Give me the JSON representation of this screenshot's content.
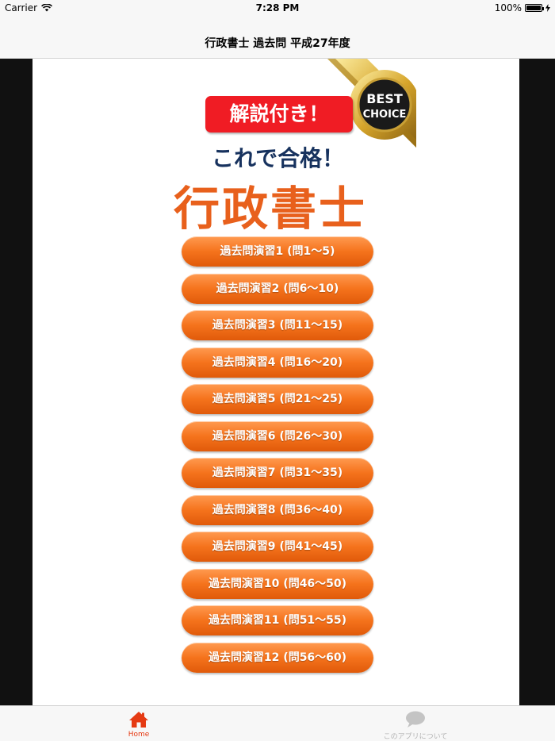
{
  "status": {
    "carrier": "Carrier",
    "time": "7:28 PM",
    "battery": "100%",
    "battery_level": 1.0
  },
  "nav": {
    "title": "行政書士 過去問 平成27年度"
  },
  "banner": {
    "label": "解説付き！",
    "sub_slogan": "これで合格！",
    "main_slogan": "行政書士",
    "badge_line1": "BEST",
    "badge_line2": "CHOICE"
  },
  "buttons": [
    {
      "label": "過去問演習1 (問1〜5)"
    },
    {
      "label": "過去問演習2 (問6〜10)"
    },
    {
      "label": "過去問演習3 (問11〜15)"
    },
    {
      "label": "過去問演習4 (問16〜20)"
    },
    {
      "label": "過去問演習5 (問21〜25)"
    },
    {
      "label": "過去問演習6 (問26〜30)"
    },
    {
      "label": "過去問演習7 (問31〜35)"
    },
    {
      "label": "過去問演習8 (問36〜40)"
    },
    {
      "label": "過去問演習9 (問41〜45)"
    },
    {
      "label": "過去問演習10 (問46〜50)"
    },
    {
      "label": "過去問演習11 (問51〜55)"
    },
    {
      "label": "過去問演習12 (問56〜60)"
    }
  ],
  "tabs": {
    "home_label": "Home",
    "about_label": "このアプリについて",
    "home_icon": "home-icon",
    "about_icon": "speech-bubble-icon"
  },
  "colors": {
    "accent": "#e53a13",
    "button_orange": "#f5731c",
    "slogan_orange": "#e8601c",
    "slogan_navy": "#17325e",
    "label_red": "#f01c24"
  }
}
